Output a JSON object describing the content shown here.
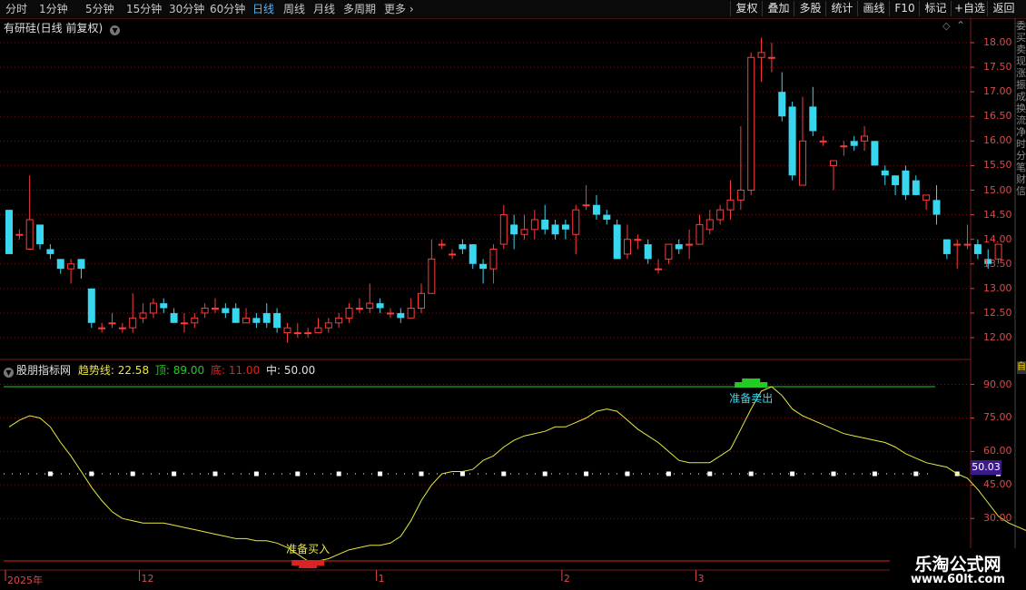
{
  "toolbar": {
    "periods": [
      "分时",
      "1分钟",
      "5分钟",
      "15分钟",
      "30分钟",
      "60分钟",
      "日线",
      "周线",
      "月线",
      "多周期",
      "更多"
    ],
    "active_period": "日线",
    "right_buttons": [
      "复权",
      "叠加",
      "多股",
      "统计",
      "画线",
      "F10",
      "标记",
      "+自选",
      "返回"
    ]
  },
  "chart_title": "有研硅(日线 前复权)",
  "indicator": {
    "name": "股朋指标网",
    "trend_label": "趋势线:",
    "trend_value": "22.58",
    "top_label": "顶:",
    "top_value": "89.00",
    "bottom_label": "底:",
    "bottom_value": "11.00",
    "mid_label": "中:",
    "mid_value": "50.00",
    "current_value": "50.03",
    "buy_label": "准备买入",
    "sell_label": "准备卖出"
  },
  "x_labels": [
    "2025年",
    "12",
    "1",
    "2",
    "3"
  ],
  "side_text": "委买卖现涨振成换流净时分笔财信",
  "side_box": "自",
  "colors": {
    "up": "#ff3b3b",
    "down": "#38d6ef",
    "trend": "#e8e840",
    "top_line": "#22cc22",
    "bottom_line": "#dd2222",
    "mid_dots": "#ffffff",
    "grid": "#6a1414",
    "axis": "#d94a4a"
  },
  "watermark": {
    "line1": "乐淘公式网",
    "line2": "www.60lt.com"
  },
  "chart_data": [
    {
      "type": "candlestick",
      "title": "有研硅(日线 前复权)",
      "y_ticks": [
        12.0,
        12.5,
        13.0,
        13.5,
        14.0,
        14.5,
        15.0,
        15.5,
        16.0,
        16.5,
        17.0,
        17.5,
        18.0
      ],
      "ylim": [
        11.7,
        18.3
      ],
      "grid": true,
      "x_labels": [
        "2025年",
        "12",
        "1",
        "2",
        "3"
      ],
      "x_label_index": [
        0,
        13,
        36,
        54,
        67
      ],
      "candles": [
        [
          14.6,
          13.7,
          14.6,
          13.7
        ],
        [
          14.1,
          14.1,
          14.2,
          14.0
        ],
        [
          13.8,
          14.4,
          15.3,
          13.8
        ],
        [
          14.3,
          13.9,
          14.3,
          13.8
        ],
        [
          13.8,
          13.7,
          13.9,
          13.6
        ],
        [
          13.6,
          13.4,
          13.6,
          13.3
        ],
        [
          13.4,
          13.5,
          13.6,
          13.1
        ],
        [
          13.6,
          13.4,
          13.6,
          13.2
        ],
        [
          13.0,
          12.3,
          13.0,
          12.2
        ],
        [
          12.2,
          12.2,
          12.3,
          12.1
        ],
        [
          12.3,
          12.3,
          12.5,
          12.2
        ],
        [
          12.2,
          12.2,
          12.3,
          12.1
        ],
        [
          12.2,
          12.4,
          12.9,
          12.1
        ],
        [
          12.4,
          12.5,
          12.7,
          12.3
        ],
        [
          12.5,
          12.7,
          12.8,
          12.4
        ],
        [
          12.7,
          12.6,
          12.8,
          12.5
        ],
        [
          12.5,
          12.3,
          12.6,
          12.3
        ],
        [
          12.3,
          12.3,
          12.5,
          12.1
        ],
        [
          12.3,
          12.4,
          12.5,
          12.2
        ],
        [
          12.5,
          12.6,
          12.7,
          12.4
        ],
        [
          12.6,
          12.6,
          12.8,
          12.5
        ],
        [
          12.6,
          12.5,
          12.7,
          12.4
        ],
        [
          12.6,
          12.3,
          12.7,
          12.3
        ],
        [
          12.3,
          12.4,
          12.6,
          12.3
        ],
        [
          12.4,
          12.3,
          12.5,
          12.2
        ],
        [
          12.5,
          12.3,
          12.7,
          12.2
        ],
        [
          12.5,
          12.2,
          12.6,
          12.1
        ],
        [
          12.1,
          12.2,
          12.3,
          11.9
        ],
        [
          12.1,
          12.1,
          12.3,
          12.0
        ],
        [
          12.1,
          12.1,
          12.2,
          12.0
        ],
        [
          12.1,
          12.2,
          12.4,
          12.1
        ],
        [
          12.2,
          12.3,
          12.4,
          12.1
        ],
        [
          12.3,
          12.4,
          12.5,
          12.2
        ],
        [
          12.4,
          12.6,
          12.7,
          12.3
        ],
        [
          12.6,
          12.6,
          12.8,
          12.5
        ],
        [
          12.6,
          12.7,
          13.1,
          12.5
        ],
        [
          12.7,
          12.6,
          12.8,
          12.5
        ],
        [
          12.5,
          12.5,
          12.6,
          12.4
        ],
        [
          12.5,
          12.4,
          12.6,
          12.3
        ],
        [
          12.4,
          12.6,
          12.8,
          12.4
        ],
        [
          12.6,
          12.9,
          13.1,
          12.5
        ],
        [
          12.9,
          13.6,
          14.0,
          12.9
        ],
        [
          13.9,
          13.9,
          14.0,
          13.8
        ],
        [
          13.7,
          13.7,
          13.8,
          13.6
        ],
        [
          13.9,
          13.8,
          14.0,
          13.7
        ],
        [
          13.9,
          13.5,
          13.9,
          13.4
        ],
        [
          13.5,
          13.4,
          13.6,
          13.1
        ],
        [
          13.4,
          13.8,
          13.9,
          13.1
        ],
        [
          13.9,
          14.5,
          14.7,
          13.8
        ],
        [
          14.3,
          14.1,
          14.5,
          13.8
        ],
        [
          14.1,
          14.2,
          14.5,
          14.0
        ],
        [
          14.2,
          14.4,
          14.6,
          14.0
        ],
        [
          14.4,
          14.2,
          14.7,
          14.1
        ],
        [
          14.3,
          14.1,
          14.4,
          14.0
        ],
        [
          14.3,
          14.2,
          14.4,
          14.0
        ],
        [
          14.1,
          14.6,
          14.7,
          13.7
        ],
        [
          14.7,
          14.7,
          15.1,
          14.6
        ],
        [
          14.7,
          14.5,
          14.9,
          14.4
        ],
        [
          14.5,
          14.4,
          14.6,
          14.3
        ],
        [
          14.3,
          13.6,
          14.4,
          13.6
        ],
        [
          13.7,
          14.0,
          14.3,
          13.6
        ],
        [
          14.0,
          14.0,
          14.1,
          13.8
        ],
        [
          13.9,
          13.6,
          14.0,
          13.5
        ],
        [
          13.4,
          13.4,
          13.6,
          13.3
        ],
        [
          13.6,
          13.9,
          13.9,
          13.5
        ],
        [
          13.9,
          13.8,
          14.0,
          13.7
        ],
        [
          13.9,
          13.9,
          14.2,
          13.6
        ],
        [
          13.9,
          14.3,
          14.5,
          13.9
        ],
        [
          14.2,
          14.4,
          14.6,
          14.1
        ],
        [
          14.4,
          14.6,
          14.7,
          14.3
        ],
        [
          14.6,
          14.8,
          15.2,
          14.4
        ],
        [
          14.8,
          15.0,
          16.3,
          14.6
        ],
        [
          15.0,
          17.7,
          17.8,
          14.9
        ],
        [
          17.7,
          17.8,
          18.1,
          17.2
        ],
        [
          17.7,
          17.7,
          18.0,
          17.4
        ],
        [
          17.0,
          16.5,
          17.4,
          16.4
        ],
        [
          16.7,
          15.3,
          16.8,
          15.2
        ],
        [
          15.1,
          16.0,
          16.9,
          15.1
        ],
        [
          16.7,
          16.2,
          17.1,
          16.1
        ],
        [
          16.0,
          16.0,
          16.1,
          15.9
        ],
        [
          15.5,
          15.6,
          15.6,
          15.0
        ],
        [
          15.9,
          15.9,
          16.0,
          15.7
        ],
        [
          16.0,
          15.9,
          16.1,
          15.8
        ],
        [
          16.0,
          16.1,
          16.3,
          15.8
        ],
        [
          16.0,
          15.5,
          16.0,
          15.5
        ],
        [
          15.4,
          15.3,
          15.5,
          15.1
        ],
        [
          15.3,
          15.1,
          15.3,
          14.9
        ],
        [
          15.4,
          14.9,
          15.5,
          14.8
        ],
        [
          15.2,
          14.9,
          15.3,
          14.9
        ],
        [
          14.8,
          14.9,
          14.9,
          14.6
        ],
        [
          14.8,
          14.5,
          15.1,
          14.3
        ],
        [
          14.0,
          13.7,
          14.0,
          13.6
        ],
        [
          13.9,
          13.9,
          14.0,
          13.4
        ],
        [
          13.9,
          13.9,
          14.3,
          13.8
        ],
        [
          13.9,
          13.7,
          14.0,
          13.6
        ],
        [
          13.6,
          13.5,
          13.8,
          13.4
        ],
        [
          13.6,
          13.9,
          13.9,
          13.5
        ]
      ]
    },
    {
      "type": "line",
      "title": "股朋指标网",
      "y_ticks": [
        30,
        45,
        60,
        75,
        90
      ],
      "ylim": [
        12,
        97
      ],
      "series": [
        {
          "name": "趋势线",
          "values": [
            71,
            74,
            76,
            75,
            71,
            64,
            58,
            51,
            44,
            38,
            33,
            30,
            29,
            28,
            28,
            28,
            27,
            26,
            25,
            24,
            23,
            22,
            21,
            21,
            20,
            20,
            19,
            17,
            14,
            11,
            11,
            12,
            14,
            16,
            17,
            18,
            18,
            19,
            22,
            29,
            38,
            45,
            50,
            51,
            51,
            52,
            56,
            58,
            62,
            65,
            67,
            68,
            69,
            71,
            71,
            73,
            75,
            78,
            79,
            78,
            74,
            70,
            67,
            64,
            60,
            56,
            55,
            55,
            55,
            58,
            61,
            70,
            79,
            87,
            89,
            85,
            79,
            76,
            74,
            72,
            70,
            68,
            67,
            66,
            65,
            64,
            62,
            59,
            57,
            55,
            54,
            53,
            50,
            48,
            43,
            37,
            31,
            28,
            26,
            24,
            23,
            22
          ]
        },
        {
          "name": "顶",
          "values": [
            89
          ]
        },
        {
          "name": "底",
          "values": [
            11
          ]
        },
        {
          "name": "中",
          "values": [
            50
          ]
        }
      ],
      "annotations": [
        {
          "text": "准备买入",
          "index": 29,
          "value": 11
        },
        {
          "text": "准备卖出",
          "index": 72,
          "value": 89
        }
      ],
      "current_value": 50.03
    }
  ]
}
